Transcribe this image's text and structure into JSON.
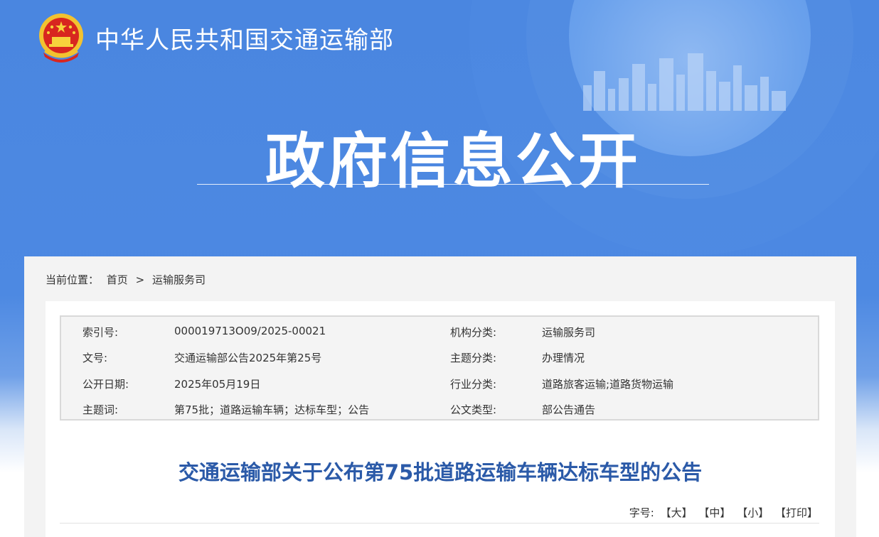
{
  "header": {
    "ministry_name": "中华人民共和国交通运输部",
    "section_title": "政府信息公开",
    "emblem_icon": "national-emblem-icon",
    "colors": {
      "banner_blue": "#4a86e0",
      "title_blue": "#2b5aa8"
    }
  },
  "breadcrumb": {
    "label": "当前位置：",
    "items": [
      "首页",
      "运输服务司"
    ],
    "separator": ">"
  },
  "meta": {
    "index_label": "索引号:",
    "index_value": "000019713O09/2025-00021",
    "org_label": "机构分类:",
    "org_value": "运输服务司",
    "doc_label": "文号:",
    "doc_value": "交通运输部公告2025年第25号",
    "topic_label": "主题分类:",
    "topic_value": "办理情况",
    "date_label": "公开日期:",
    "date_value": "2025年05月19日",
    "industry_label": "行业分类:",
    "industry_value": "道路旅客运输;道路货物运输",
    "keywords_label": "主题词:",
    "keywords_value": "第75批；道路运输车辆；达标车型；公告",
    "type_label": "公文类型:",
    "type_value": "部公告通告"
  },
  "article": {
    "title": "交通运输部关于公布第75批道路运输车辆达标车型的公告"
  },
  "font_size": {
    "label": "字号:",
    "large": "【大】",
    "medium": "【中】",
    "small": "【小】",
    "print": "【打印】"
  }
}
